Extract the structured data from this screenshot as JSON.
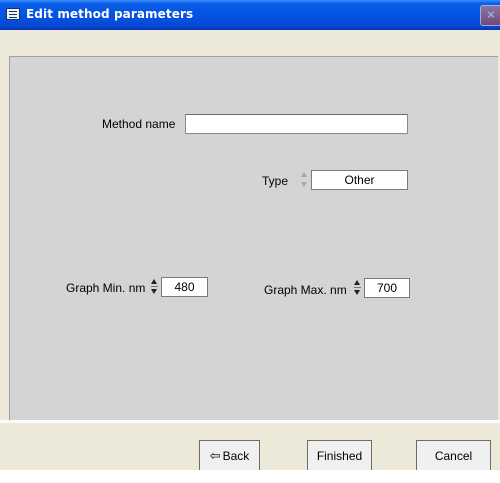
{
  "window": {
    "title": "Edit method parameters",
    "close_glyph": "×",
    "app_icon": "window-menu-icon"
  },
  "form": {
    "method_name": {
      "label": "Method name",
      "value": ""
    },
    "type": {
      "label": "Type",
      "value": "Other"
    },
    "graph_min": {
      "label": "Graph Min. nm",
      "value": "480"
    },
    "graph_max": {
      "label": "Graph Max. nm",
      "value": "700"
    }
  },
  "buttons": {
    "back": "Back",
    "back_icon": "⇦",
    "finished": "Finished",
    "cancel": "Cancel"
  }
}
